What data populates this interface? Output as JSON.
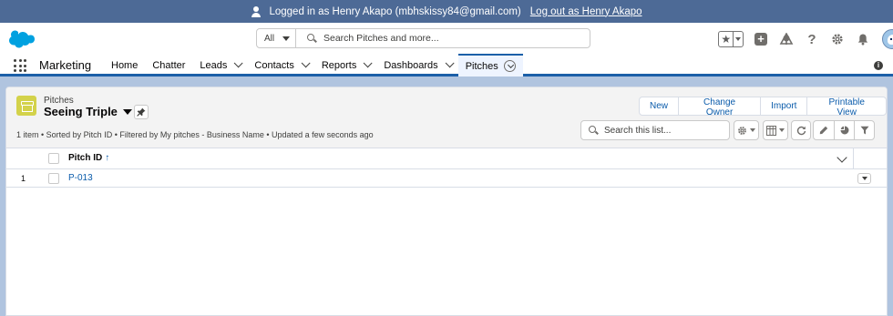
{
  "banner": {
    "logged_in_text": "Logged in as Henry Akapo (mbhskissy84@gmail.com)",
    "logout_text": "Log out as Henry Akapo"
  },
  "header": {
    "search_scope": "All",
    "search_placeholder": "Search Pitches and more...",
    "icons": [
      "star-icon",
      "plus-icon",
      "trailhead-icon",
      "help-icon",
      "gear-icon",
      "bell-icon",
      "avatar"
    ]
  },
  "nav": {
    "app_name": "Marketing",
    "items": [
      {
        "label": "Home",
        "has_menu": false
      },
      {
        "label": "Chatter",
        "has_menu": false
      },
      {
        "label": "Leads",
        "has_menu": true
      },
      {
        "label": "Contacts",
        "has_menu": true
      },
      {
        "label": "Reports",
        "has_menu": true
      },
      {
        "label": "Dashboards",
        "has_menu": true
      },
      {
        "label": "Pitches",
        "has_menu": true,
        "active": true
      }
    ]
  },
  "list_view": {
    "object_label": "Pitches",
    "view_name": "Seeing Triple",
    "meta": "1 item • Sorted by Pitch ID • Filtered by My pitches - Business Name • Updated a few seconds ago",
    "buttons": {
      "new": "New",
      "change_owner": "Change Owner",
      "import": "Import",
      "printable_view": "Printable View"
    },
    "search_placeholder": "Search this list...",
    "column_header": "Pitch ID",
    "sort_arrow": "↑",
    "rows": [
      {
        "num": "1",
        "pitch_id": "P-013"
      }
    ]
  },
  "colors": {
    "banner_bg": "#4d6a96",
    "brand_blue": "#0b5cab",
    "pitch_icon": "#d3d24a",
    "nav_active_border": "#1b5fa8"
  }
}
